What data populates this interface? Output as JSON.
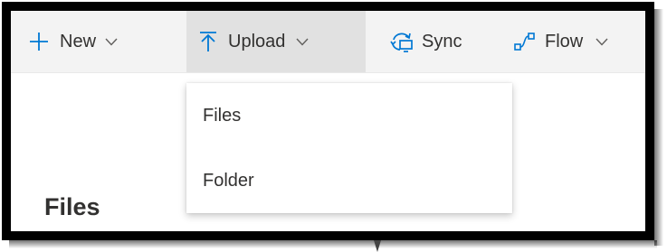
{
  "toolbar": {
    "new_label": "New",
    "upload_label": "Upload",
    "sync_label": "Sync",
    "flow_label": "Flow",
    "accent_color": "#0078d4",
    "icons": {
      "new": "plus-icon",
      "upload": "upload-arrow-icon",
      "sync": "sync-icon",
      "flow": "flow-icon",
      "chevron": "chevron-down-icon"
    }
  },
  "upload_menu": {
    "items": [
      {
        "label": "Files"
      },
      {
        "label": "Folder"
      }
    ]
  },
  "page": {
    "title": "Files"
  }
}
